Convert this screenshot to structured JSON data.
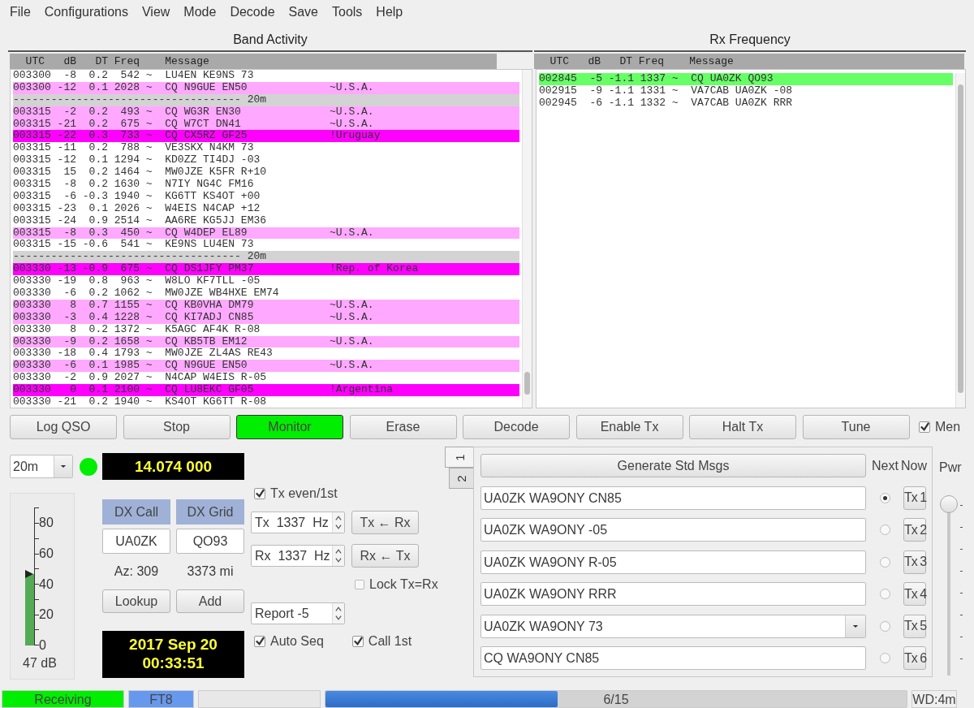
{
  "menu": [
    "File",
    "Configurations",
    "View",
    "Mode",
    "Decode",
    "Save",
    "Tools",
    "Help"
  ],
  "band_activity": {
    "title": "Band Activity",
    "columns": [
      "UTC",
      "dB",
      "DT",
      "Freq",
      "Message"
    ],
    "rows": [
      {
        "kind": "plain",
        "text": "003300  -8  0.2  542 ~  LU4EN KE9NS 73"
      },
      {
        "kind": "cq",
        "text": "003300 -12  0.1 2028 ~  CQ N9GUE EN50             ~U.S.A."
      },
      {
        "kind": "separator",
        "text": "------------------------------------ 20m"
      },
      {
        "kind": "cq",
        "text": "003315  -2  0.2  493 ~  CQ WG3R EN30              ~U.S.A."
      },
      {
        "kind": "cq",
        "text": "003315 -21  0.2  675 ~  CQ W7CT DN41              ~U.S.A."
      },
      {
        "kind": "new",
        "text": "003315 -22  0.3  733 ~  CQ CX5RZ GF25             !Uruguay"
      },
      {
        "kind": "plain",
        "text": "003315 -11  0.2  788 ~  VE3SKX N4KM 73"
      },
      {
        "kind": "plain",
        "text": "003315 -12  0.1 1294 ~  KD0ZZ TI4DJ -03"
      },
      {
        "kind": "plain",
        "text": "003315  15  0.2 1464 ~  MW0JZE K5FR R+10"
      },
      {
        "kind": "plain",
        "text": "003315  -8  0.2 1630 ~  N7IY NG4C FM16"
      },
      {
        "kind": "plain",
        "text": "003315  -6 -0.3 1940 ~  KG6TT KS4OT +00"
      },
      {
        "kind": "plain",
        "text": "003315 -23  0.1 2026 ~  W4EIS N4CAP +12"
      },
      {
        "kind": "plain",
        "text": "003315 -24  0.9 2514 ~  AA6RE KG5JJ EM36"
      },
      {
        "kind": "cq",
        "text": "003315  -8  0.3  450 ~  CQ W4DEP EL89             ~U.S.A."
      },
      {
        "kind": "plain",
        "text": "003315 -15 -0.6  541 ~  KE9NS LU4EN 73"
      },
      {
        "kind": "separator",
        "text": "------------------------------------ 20m"
      },
      {
        "kind": "new",
        "text": "003330 -13 -0.9  675 ~  CQ DS1JFY PM37            !Rep. of Korea"
      },
      {
        "kind": "plain",
        "text": "003330 -19  0.8  963 ~  W8LO KF7TLL -05"
      },
      {
        "kind": "plain",
        "text": "003330  -6  0.2 1062 ~  MW0JZE WB4HXE EM74"
      },
      {
        "kind": "cq",
        "text": "003330   8  0.7 1155 ~  CQ KB0VHA DM79            ~U.S.A."
      },
      {
        "kind": "cq",
        "text": "003330  -3  0.4 1228 ~  CQ KI7ADJ CN85            ~U.S.A."
      },
      {
        "kind": "plain",
        "text": "003330   8  0.2 1372 ~  K5AGC AF4K R-08"
      },
      {
        "kind": "cq",
        "text": "003330  -9  0.2 1658 ~  CQ KB5TB EM12             ~U.S.A."
      },
      {
        "kind": "plain",
        "text": "003330 -18  0.4 1793 ~  MW0JZE ZL4AS RE43"
      },
      {
        "kind": "cq",
        "text": "003330  -6  0.1 1985 ~  CQ N9GUE EN50             ~U.S.A."
      },
      {
        "kind": "plain",
        "text": "003330  -2  0.9 2027 ~  N4CAP W4EIS R-05"
      },
      {
        "kind": "new",
        "text": "003330   0  0.1 2100 ~  CQ LU8EKC GF05            !Argentina"
      },
      {
        "kind": "plain",
        "text": "003330 -21  0.2 1940 ~  KS4OT KG6TT R-08"
      }
    ]
  },
  "rx_frequency": {
    "title": "Rx Frequency",
    "columns": [
      "UTC",
      "dB",
      "DT",
      "Freq",
      "Message"
    ],
    "rows": [
      {
        "kind": "own",
        "text": "002845  -5 -1.1 1337 ~  CQ UA0ZK QO93"
      },
      {
        "kind": "plain",
        "text": "002915  -9 -1.1 1331 ~  VA7CAB UA0ZK -08"
      },
      {
        "kind": "plain",
        "text": "002945  -6 -1.1 1332 ~  VA7CAB UA0ZK RRR"
      }
    ]
  },
  "buttons": [
    {
      "label": "Log QSO",
      "active": false
    },
    {
      "label": "Stop",
      "active": false
    },
    {
      "label": "Monitor",
      "active": true
    },
    {
      "label": "Erase",
      "active": false
    },
    {
      "label": "Decode",
      "active": false
    },
    {
      "label": "Enable Tx",
      "active": false
    },
    {
      "label": "Halt Tx",
      "active": false
    },
    {
      "label": "Tune",
      "active": false
    }
  ],
  "menus_checkbox": {
    "label": "Men",
    "checked": true
  },
  "band": "20m",
  "rig_led": {
    "on": true
  },
  "frequency": "14.074 000",
  "meter": {
    "ticks": [
      "80",
      "60",
      "40",
      "20",
      "0"
    ],
    "level": 0.52,
    "reading": "47 dB"
  },
  "dx": {
    "call_label": "DX Call",
    "grid_label": "DX Grid",
    "call": "UA0ZK",
    "grid": "QO93",
    "azimuth": "Az: 309",
    "distance": "3373 mi",
    "lookup": "Lookup",
    "add": "Add"
  },
  "clock": {
    "date": "2017 Sep 20",
    "time": "00:33:51"
  },
  "tx_even": {
    "label": "Tx even/1st",
    "checked": true
  },
  "tx_freq": "Tx  1337  Hz",
  "rx_freq": "Rx  1337  Hz",
  "tx_from_rx": "Tx ← Rx",
  "rx_from_tx": "Rx ← Tx",
  "lock": {
    "label": "Lock Tx=Rx",
    "checked": false
  },
  "report": "Report -5",
  "auto_seq": {
    "label": "Auto Seq",
    "checked": true
  },
  "call_first": {
    "label": "Call 1st",
    "checked": true
  },
  "message_tabs": [
    {
      "label": "1",
      "selected": true
    },
    {
      "label": "2",
      "selected": false
    }
  ],
  "messages": {
    "generate": "Generate Std Msgs",
    "next_label": "Next",
    "now_label": "Now",
    "rows": [
      {
        "kind": "field",
        "text": "UA0ZK WA9ONY CN85",
        "selected": true,
        "button": "Tx 1"
      },
      {
        "kind": "field",
        "text": "UA0ZK WA9ONY -05",
        "selected": false,
        "button": "Tx 2"
      },
      {
        "kind": "field",
        "text": "UA0ZK WA9ONY R-05",
        "selected": false,
        "button": "Tx 3"
      },
      {
        "kind": "field",
        "text": "UA0ZK WA9ONY RRR",
        "selected": false,
        "button": "Tx 4"
      },
      {
        "kind": "combo",
        "text": "UA0ZK WA9ONY 73",
        "selected": false,
        "button": "Tx 5"
      },
      {
        "kind": "field",
        "text": "CQ WA9ONY CN85",
        "selected": false,
        "button": "Tx 6"
      }
    ]
  },
  "power": {
    "label": "Pwr",
    "level": 1
  },
  "status_bar": {
    "state": "Receiving",
    "mode": "FT8",
    "progress": {
      "level": 0.4,
      "text": "6/15"
    },
    "watchdog": "WD:4m"
  }
}
